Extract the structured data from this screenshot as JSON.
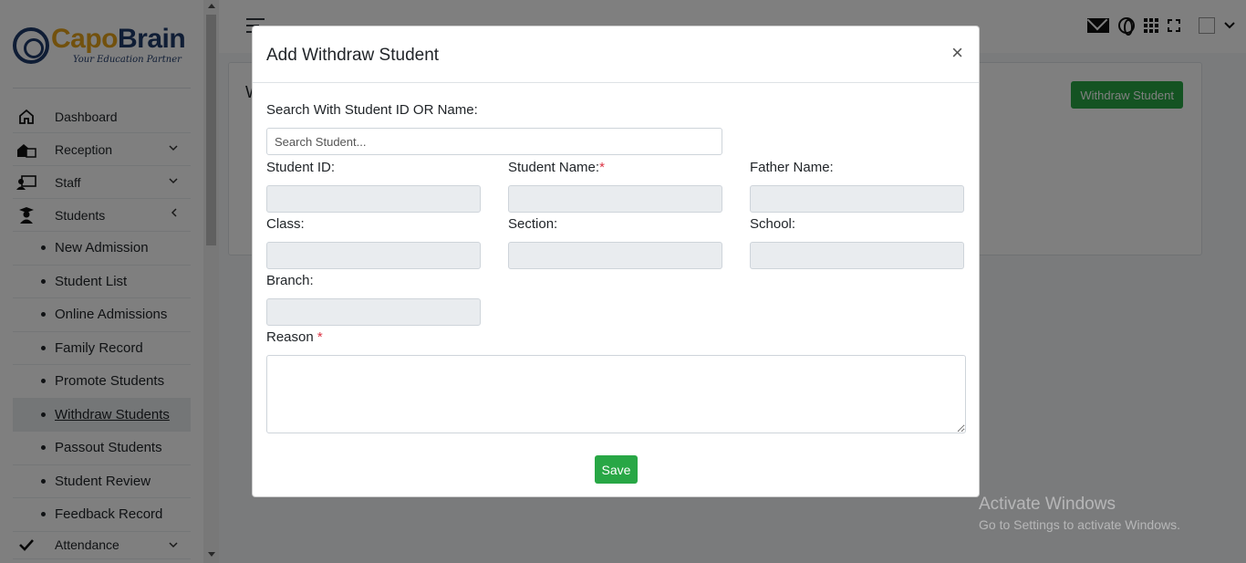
{
  "brand": {
    "name_part1": "Capo",
    "name_part2": "Brain",
    "tagline": "Your Education Partner"
  },
  "sidebar": {
    "items": [
      {
        "label": "Dashboard",
        "icon": "home-icon"
      },
      {
        "label": "Reception",
        "icon": "reception-icon"
      },
      {
        "label": "Staff",
        "icon": "staff-icon"
      },
      {
        "label": "Students",
        "icon": "student-icon"
      }
    ],
    "student_subitems": [
      "New Admission",
      "Student List",
      "Online Admissions",
      "Family Record",
      "Promote Students",
      "Withdraw Students",
      "Passout Students",
      "Student Review",
      "Feedback Record"
    ],
    "active_subitem": "Withdraw Students",
    "attendance_label": "Attendance"
  },
  "page": {
    "title_partial": "W",
    "withdraw_button": "Withdraw Student"
  },
  "modal": {
    "title": "Add Withdraw Student",
    "close": "×",
    "search_label": "Search With Student ID OR Name:",
    "search_placeholder": "Search Student...",
    "fields": {
      "student_id": "Student ID:",
      "student_name": "Student Name:",
      "father_name": "Father Name:",
      "class": "Class:",
      "section": "Section:",
      "school": "School:",
      "branch": "Branch:",
      "reason": "Reason"
    },
    "required_mark": "*",
    "save": "Save"
  },
  "watermark": {
    "line1": "Activate Windows",
    "line2": "Go to Settings to activate Windows."
  },
  "colors": {
    "brand_orange": "#e4a21a",
    "brand_navy": "#1f3a6b",
    "success_green": "#28a745",
    "required_red": "#dc3545"
  }
}
